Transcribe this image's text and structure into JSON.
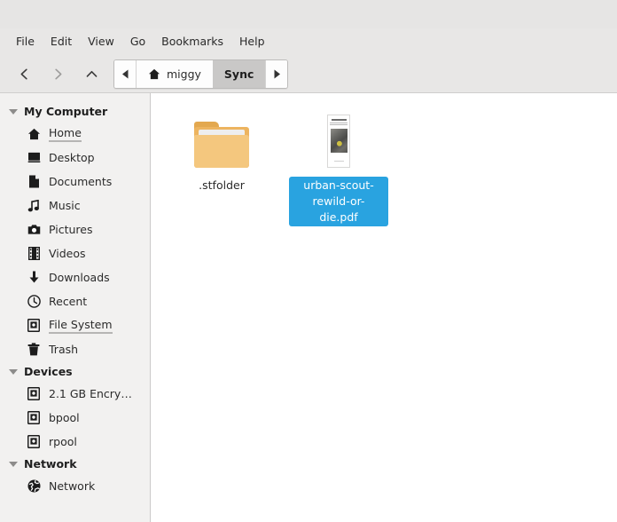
{
  "window": {
    "titlebar": ""
  },
  "menubar": {
    "items": [
      {
        "label": "File"
      },
      {
        "label": "Edit"
      },
      {
        "label": "View"
      },
      {
        "label": "Go"
      },
      {
        "label": "Bookmarks"
      },
      {
        "label": "Help"
      }
    ]
  },
  "toolbar": {
    "back": {
      "name": "back-button",
      "enabled": true
    },
    "forward": {
      "name": "forward-button",
      "enabled": false
    },
    "up": {
      "name": "up-button",
      "enabled": true
    },
    "pathbar": {
      "scroll_left": "◀",
      "scroll_right": "▶",
      "crumbs": [
        {
          "label": "miggy",
          "icon": "home-icon",
          "active": false
        },
        {
          "label": "Sync",
          "icon": "",
          "active": true
        }
      ]
    }
  },
  "sidebar": {
    "sections": [
      {
        "label": "My Computer",
        "items": [
          {
            "label": "Home",
            "icon": "home-icon",
            "underlined": true
          },
          {
            "label": "Desktop",
            "icon": "desktop-icon",
            "underlined": false
          },
          {
            "label": "Documents",
            "icon": "document-icon",
            "underlined": false
          },
          {
            "label": "Music",
            "icon": "music-note-icon",
            "underlined": false
          },
          {
            "label": "Pictures",
            "icon": "camera-icon",
            "underlined": false
          },
          {
            "label": "Videos",
            "icon": "film-icon",
            "underlined": false
          },
          {
            "label": "Downloads",
            "icon": "download-arrow-icon",
            "underlined": false
          },
          {
            "label": "Recent",
            "icon": "clock-icon",
            "underlined": false
          },
          {
            "label": "File System",
            "icon": "drive-icon",
            "underlined": true
          },
          {
            "label": "Trash",
            "icon": "trash-icon",
            "underlined": false
          }
        ]
      },
      {
        "label": "Devices",
        "items": [
          {
            "label": "2.1 GB Encry…",
            "icon": "drive-icon",
            "underlined": false
          },
          {
            "label": "bpool",
            "icon": "drive-icon",
            "underlined": false
          },
          {
            "label": "rpool",
            "icon": "drive-icon",
            "underlined": false
          }
        ]
      },
      {
        "label": "Network",
        "items": [
          {
            "label": "Network",
            "icon": "globe-icon",
            "underlined": false
          }
        ]
      }
    ]
  },
  "files": {
    "items": [
      {
        "name": ".stfolder",
        "kind": "folder",
        "selected": false
      },
      {
        "name": "urban-scout-rewild-or-die.pdf",
        "kind": "pdf",
        "selected": true
      }
    ]
  },
  "colors": {
    "selection": "#29a3e0",
    "folder": "#f4c77e",
    "sidebar_bg": "#f2f1f0",
    "toolbar_bg": "#e8e7e6",
    "pane_bg": "#ffffff"
  }
}
